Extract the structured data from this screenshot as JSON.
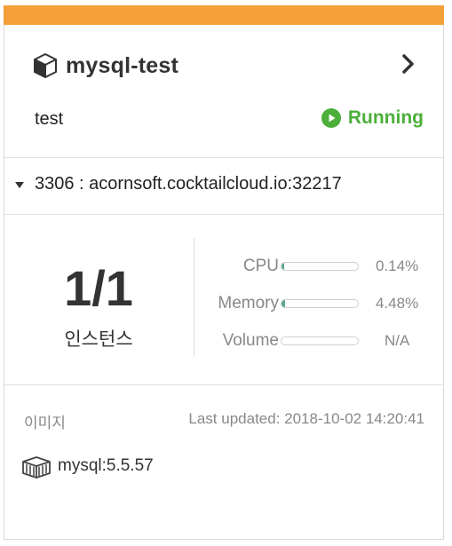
{
  "card": {
    "accent_color": "#f4a03a",
    "title": "mysql-test",
    "title_icon": "cube-icon",
    "namespace": "test",
    "status": {
      "label": "Running",
      "color": "#4caf3a",
      "icon": "play-circle-icon"
    },
    "nav_icon": "chevron-right-icon"
  },
  "endpoint": {
    "text": "3306 : acornsoft.cocktailcloud.io:32217",
    "icon": "caret-down-icon"
  },
  "instances": {
    "count": "1/1",
    "label": "인스턴스"
  },
  "metrics": [
    {
      "label": "CPU",
      "value": "0.14%",
      "fraction": 0.0014
    },
    {
      "label": "Memory",
      "value": "4.48%",
      "fraction": 0.0448
    },
    {
      "label": "Volume",
      "value": "N/A",
      "fraction": 0
    }
  ],
  "footer": {
    "image_label": "이미지",
    "last_updated": "Last updated: 2018-10-02 14:20:41",
    "image_name": "mysql:5.5.57",
    "image_icon": "container-icon"
  }
}
